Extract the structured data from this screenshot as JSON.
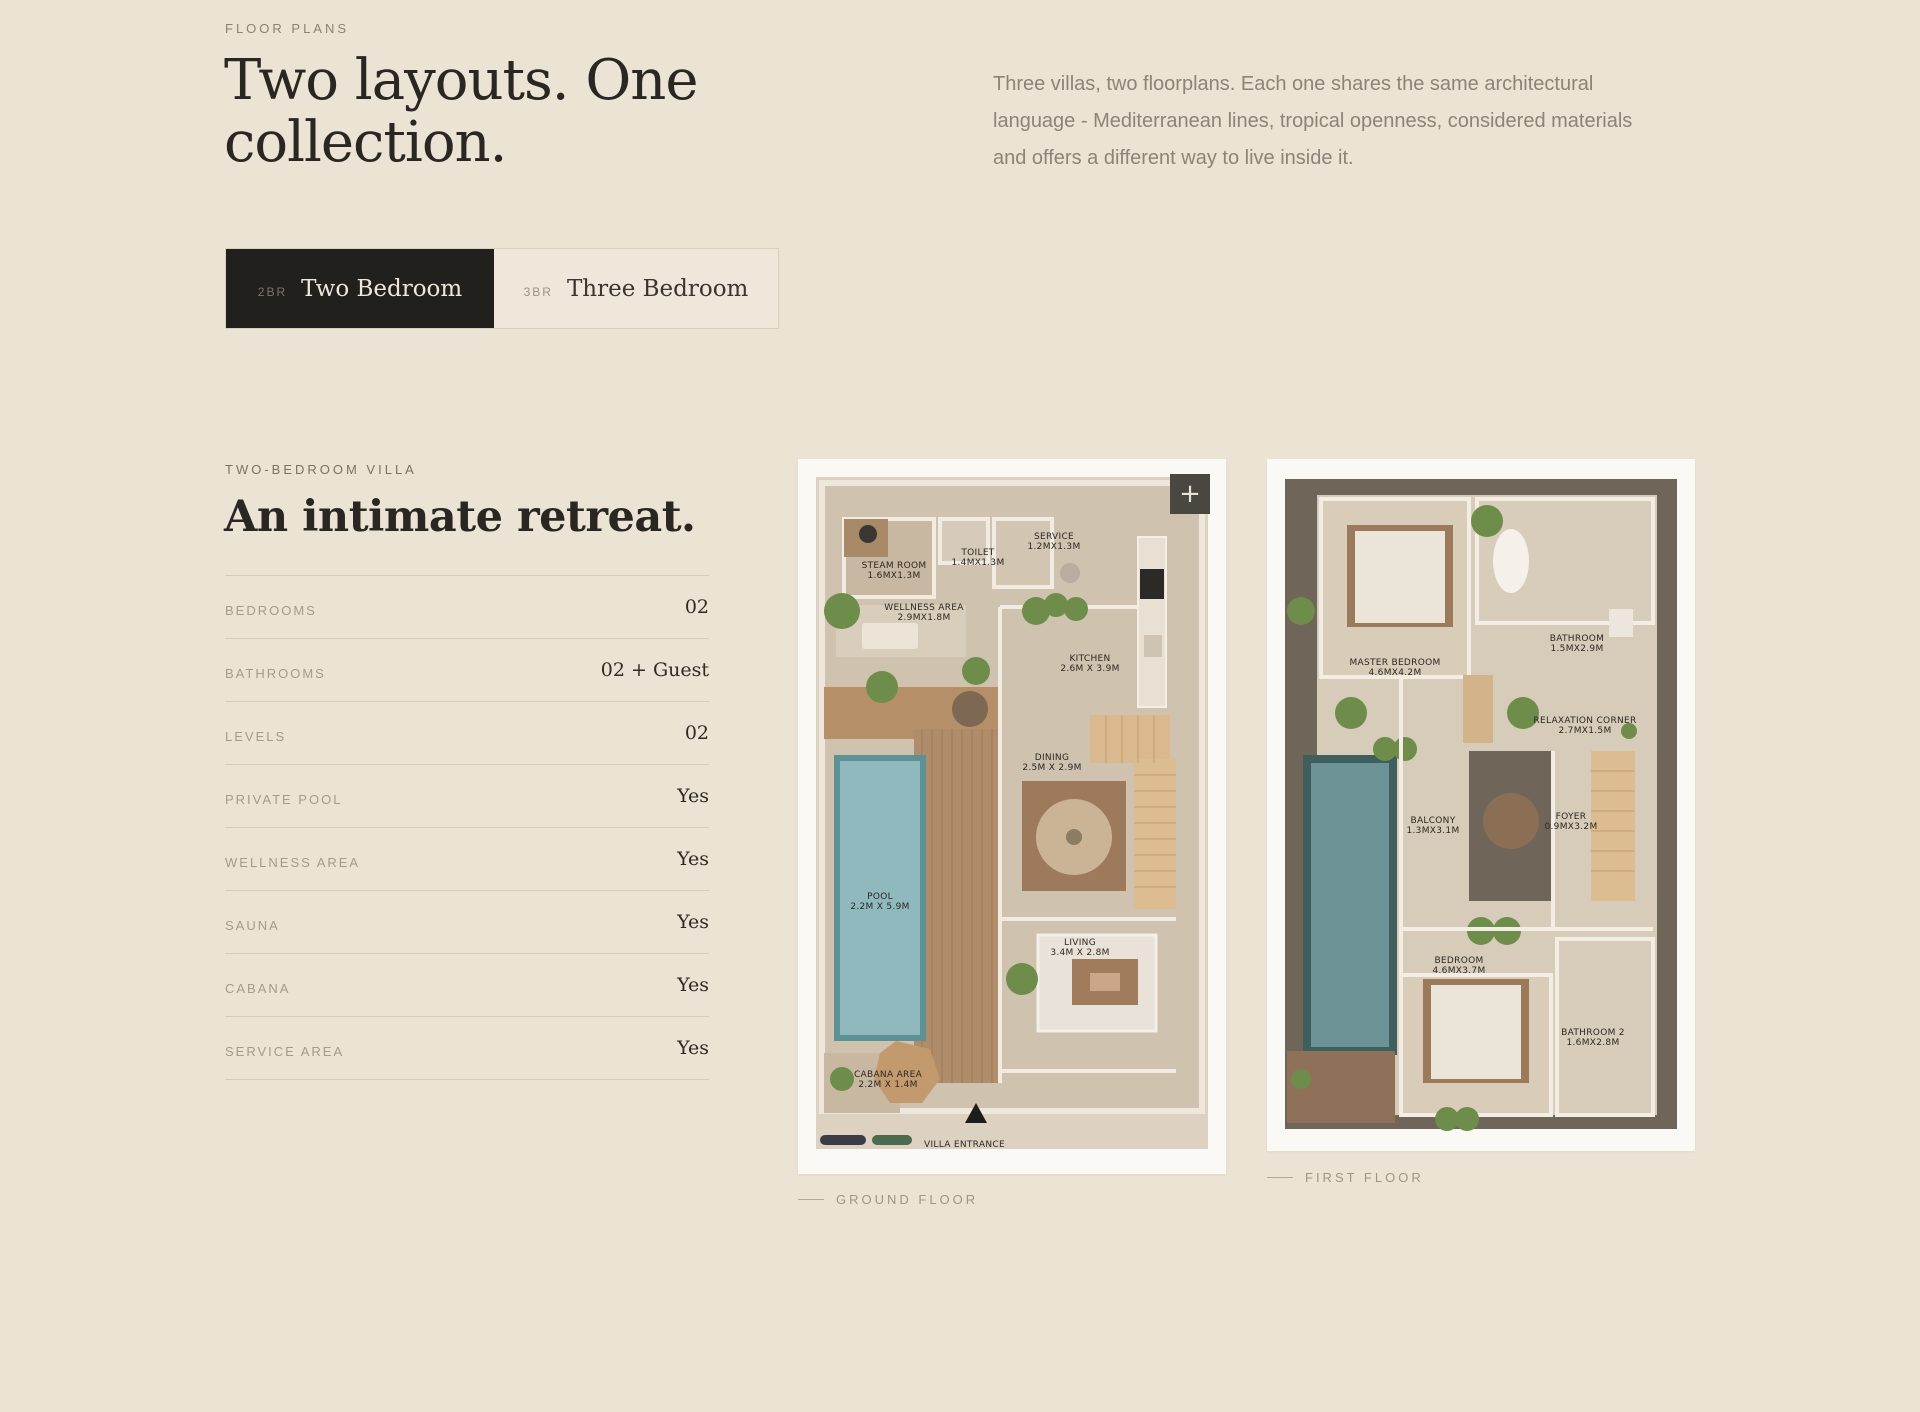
{
  "header": {
    "eyebrow": "FLOOR PLANS",
    "title": "Two layouts.  One collection.",
    "intro": "Three villas, two floorplans. Each one shares the same architectural language - Mediterranean lines, tropical openness, considered materials and offers a different way to live inside it."
  },
  "tabs": [
    {
      "code": "2BR",
      "label": "Two Bedroom",
      "active": true
    },
    {
      "code": "3BR",
      "label": "Three Bedroom",
      "active": false
    }
  ],
  "villa": {
    "eyebrow": "TWO-BEDROOM VILLA",
    "title": "An intimate retreat.",
    "specs": [
      {
        "label": "BEDROOMS",
        "value": "02"
      },
      {
        "label": "BATHROOMS",
        "value": "02 + Guest"
      },
      {
        "label": "LEVELS",
        "value": "02"
      },
      {
        "label": "PRIVATE POOL",
        "value": "Yes"
      },
      {
        "label": "WELLNESS AREA",
        "value": "Yes"
      },
      {
        "label": "SAUNA",
        "value": "Yes"
      },
      {
        "label": "CABANA",
        "value": "Yes"
      },
      {
        "label": "SERVICE AREA",
        "value": "Yes"
      }
    ]
  },
  "plans": {
    "zoom_icon": "plus-icon",
    "ground": {
      "caption": "GROUND FLOOR",
      "rooms": {
        "steam_name": "STEAM ROOM",
        "steam_dim": "1.6MX1.3M",
        "toilet_name": "TOILET",
        "toilet_dim": "1.4MX1.3M",
        "service_name": "SERVICE",
        "service_dim": "1.2MX1.3M",
        "wellness_name": "WELLNESS AREA",
        "wellness_dim": "2.9MX1.8M",
        "kitchen_name": "KITCHEN",
        "kitchen_dim": "2.6M X 3.9M",
        "dining_name": "DINING",
        "dining_dim": "2.5M X 2.9M",
        "pool_name": "POOL",
        "pool_dim": "2.2M X 5.9M",
        "living_name": "LIVING",
        "living_dim": "3.4M X 2.8M",
        "cabana_name": "CABANA AREA",
        "cabana_dim": "2.2M X 1.4M",
        "entrance": "VILLA ENTRANCE"
      }
    },
    "first": {
      "caption": "FIRST FLOOR",
      "rooms": {
        "master_name": "MASTER BEDROOM",
        "master_dim": "4.6MX4.2M",
        "bath1_name": "BATHROOM",
        "bath1_dim": "1.5MX2.9M",
        "relax_name": "RELAXATION CORNER",
        "relax_dim": "2.7MX1.5M",
        "balcony_name": "BALCONY",
        "balcony_dim": "1.3MX3.1M",
        "foyer_name": "FOYER",
        "foyer_dim": "0.9MX3.2M",
        "bedroom_name": "BEDROOM",
        "bedroom_dim": "4.6MX3.7M",
        "bath2_name": "BATHROOM 2",
        "bath2_dim": "1.6MX2.8M"
      }
    }
  },
  "colors": {
    "background": "#ebe3d3",
    "ink": "#22201c",
    "pool": "#8fb9bd",
    "deck": "#b08d6a"
  }
}
